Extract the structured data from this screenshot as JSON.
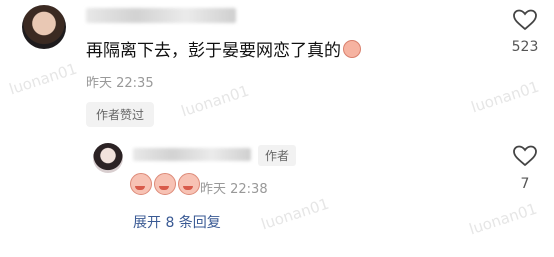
{
  "comment": {
    "text": "再隔离下去，彭于晏要网恋了真的",
    "time": "昨天 22:35",
    "author_liked_label": "作者赞过",
    "like_count": "523"
  },
  "reply": {
    "author_badge": "作者",
    "time": "昨天 22:38",
    "like_count": "7"
  },
  "expand_replies_label": "展开 8 条回复",
  "watermark": "luonan01"
}
